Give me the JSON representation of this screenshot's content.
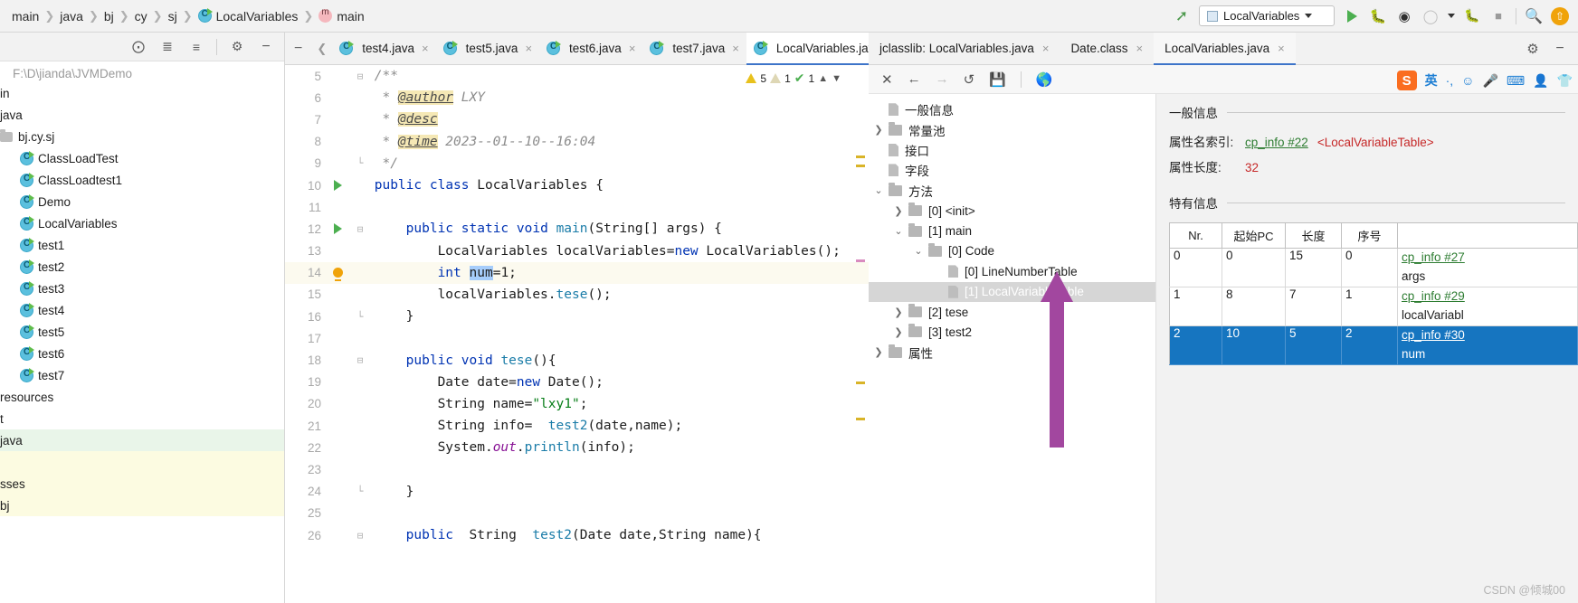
{
  "breadcrumb": {
    "items": [
      "main",
      "java",
      "bj",
      "cy",
      "sj"
    ],
    "class_name": "LocalVariables",
    "method_name": "main"
  },
  "toolbar": {
    "run_config": "LocalVariables",
    "icons": [
      "hammer-icon",
      "run-icon",
      "debug-icon",
      "run-coverage-icon",
      "profiler-icon",
      "attach-icon",
      "stop-icon",
      "search-icon",
      "update-icon"
    ]
  },
  "project_panel": {
    "toolbar_icons": [
      "locate-icon",
      "expand-all-icon",
      "collapse-all-icon",
      "settings-icon",
      "minimize-icon"
    ],
    "root_path": "F:\\D\\jianda\\JVMDemo",
    "items": [
      {
        "label": "in",
        "icon": "none",
        "indent": 0,
        "highlight": ""
      },
      {
        "label": "java",
        "icon": "none",
        "indent": 0,
        "highlight": ""
      },
      {
        "label": "bj.cy.sj",
        "icon": "folder",
        "indent": 0,
        "highlight": ""
      },
      {
        "label": "ClassLoadTest",
        "icon": "class",
        "indent": 1,
        "highlight": ""
      },
      {
        "label": "ClassLoadtest1",
        "icon": "class",
        "indent": 1,
        "highlight": ""
      },
      {
        "label": "Demo",
        "icon": "class",
        "indent": 1,
        "highlight": ""
      },
      {
        "label": "LocalVariables",
        "icon": "class",
        "indent": 1,
        "highlight": ""
      },
      {
        "label": "test1",
        "icon": "class",
        "indent": 1,
        "highlight": ""
      },
      {
        "label": "test2",
        "icon": "class",
        "indent": 1,
        "highlight": ""
      },
      {
        "label": "test3",
        "icon": "class",
        "indent": 1,
        "highlight": ""
      },
      {
        "label": "test4",
        "icon": "class",
        "indent": 1,
        "highlight": ""
      },
      {
        "label": "test5",
        "icon": "class",
        "indent": 1,
        "highlight": ""
      },
      {
        "label": "test6",
        "icon": "class",
        "indent": 1,
        "highlight": ""
      },
      {
        "label": "test7",
        "icon": "class",
        "indent": 1,
        "highlight": ""
      },
      {
        "label": "resources",
        "icon": "none",
        "indent": 0,
        "highlight": ""
      },
      {
        "label": "t",
        "icon": "none",
        "indent": 0,
        "highlight": ""
      },
      {
        "label": "java",
        "icon": "none",
        "indent": 0,
        "highlight": "green"
      },
      {
        "label": "",
        "icon": "none",
        "indent": 0,
        "highlight": "yellow"
      },
      {
        "label": "sses",
        "icon": "none",
        "indent": 0,
        "highlight": "yellow"
      },
      {
        "label": "bj",
        "icon": "none",
        "indent": 0,
        "highlight": "yellow"
      }
    ]
  },
  "editor": {
    "tabs": [
      {
        "label": "test4.java",
        "active": false
      },
      {
        "label": "test5.java",
        "active": false
      },
      {
        "label": "test6.java",
        "active": false
      },
      {
        "label": "test7.java",
        "active": false
      },
      {
        "label": "LocalVariables.java",
        "active": true
      }
    ],
    "inspections": {
      "warnings": "5",
      "weak_warnings": "1",
      "checks": "1"
    },
    "lines": [
      {
        "n": "5",
        "mark": "",
        "fold": "minus"
      },
      {
        "n": "6",
        "mark": "",
        "fold": ""
      },
      {
        "n": "7",
        "mark": "",
        "fold": ""
      },
      {
        "n": "8",
        "mark": "",
        "fold": ""
      },
      {
        "n": "9",
        "mark": "",
        "fold": "end"
      },
      {
        "n": "10",
        "mark": "run",
        "fold": ""
      },
      {
        "n": "11",
        "mark": "",
        "fold": ""
      },
      {
        "n": "12",
        "mark": "run",
        "fold": "minus"
      },
      {
        "n": "13",
        "mark": "",
        "fold": ""
      },
      {
        "n": "14",
        "mark": "bulb",
        "fold": "",
        "highlight": true
      },
      {
        "n": "15",
        "mark": "",
        "fold": ""
      },
      {
        "n": "16",
        "mark": "",
        "fold": "end"
      },
      {
        "n": "17",
        "mark": "",
        "fold": ""
      },
      {
        "n": "18",
        "mark": "",
        "fold": "minus"
      },
      {
        "n": "19",
        "mark": "",
        "fold": ""
      },
      {
        "n": "20",
        "mark": "",
        "fold": ""
      },
      {
        "n": "21",
        "mark": "",
        "fold": ""
      },
      {
        "n": "22",
        "mark": "",
        "fold": ""
      },
      {
        "n": "23",
        "mark": "",
        "fold": ""
      },
      {
        "n": "24",
        "mark": "",
        "fold": "end"
      },
      {
        "n": "25",
        "mark": "",
        "fold": ""
      },
      {
        "n": "26",
        "mark": "",
        "fold": "minus"
      }
    ],
    "code_text": [
      " /**",
      "  * @author LXY",
      "  * @desc",
      "  * @time 2023--01--10--16:04",
      "  */",
      " public class LocalVariables {",
      "",
      "     public static void main(String[] args) {",
      "         LocalVariables localVariables=new LocalVariables();",
      "         int num=1;",
      "         localVariables.tese();",
      "     }",
      "",
      "     public void tese(){",
      "         Date date=new Date();",
      "         String name=\"lxy1\";",
      "         String info=  test2(date,name);",
      "         System.out.println(info);",
      "",
      "     }",
      "",
      "     public  String  test2(Date date,String name){"
    ]
  },
  "jclasslib": {
    "tabs": [
      {
        "label": "jclasslib:   LocalVariables.java",
        "active": false,
        "closable": true
      },
      {
        "label": "Date.class",
        "active": false,
        "closable": true
      },
      {
        "label": "LocalVariables.java",
        "active": true,
        "closable": true
      }
    ],
    "toolbar_icons": [
      "close-icon",
      "back-icon",
      "forward-icon",
      "reload-icon",
      "save-icon",
      "browse-icon"
    ],
    "tree": [
      {
        "label": "一般信息",
        "icon": "doc",
        "indent": 1,
        "arrow": "",
        "selected": false
      },
      {
        "label": "常量池",
        "icon": "folder",
        "indent": 1,
        "arrow": "right",
        "selected": false
      },
      {
        "label": "接口",
        "icon": "doc",
        "indent": 1,
        "arrow": "",
        "selected": false
      },
      {
        "label": "字段",
        "icon": "doc",
        "indent": 1,
        "arrow": "",
        "selected": false
      },
      {
        "label": "方法",
        "icon": "folder",
        "indent": 1,
        "arrow": "down",
        "selected": false
      },
      {
        "label": "[0] <init>",
        "icon": "folder",
        "indent": 2,
        "arrow": "right",
        "selected": false
      },
      {
        "label": "[1] main",
        "icon": "folder",
        "indent": 2,
        "arrow": "down",
        "selected": false
      },
      {
        "label": "[0] Code",
        "icon": "folder",
        "indent": 3,
        "arrow": "down",
        "selected": false
      },
      {
        "label": "[0] LineNumberTable",
        "icon": "doc",
        "indent": 4,
        "arrow": "",
        "selected": false
      },
      {
        "label": "[1] LocalVariableTable",
        "icon": "doc",
        "indent": 4,
        "arrow": "",
        "selected": true
      },
      {
        "label": "[2] tese",
        "icon": "folder",
        "indent": 2,
        "arrow": "right",
        "selected": false
      },
      {
        "label": "[3] test2",
        "icon": "folder",
        "indent": 2,
        "arrow": "right",
        "selected": false
      },
      {
        "label": "属性",
        "icon": "folder",
        "indent": 1,
        "arrow": "right",
        "selected": false
      }
    ],
    "general_section": {
      "title": "一般信息",
      "attr_name_label": "属性名索引:",
      "attr_name_link": "cp_info #22",
      "attr_name_value": "<LocalVariableTable>",
      "attr_len_label": "属性长度:",
      "attr_len_value": "32"
    },
    "specific_section": {
      "title": "特有信息",
      "columns": [
        "Nr.",
        "起始PC",
        "长度",
        "序号",
        ""
      ],
      "rows": [
        {
          "nr": "0",
          "start_pc": "0",
          "length": "15",
          "index": "0",
          "name_link": "cp_info #27",
          "name_value": "args",
          "selected": false
        },
        {
          "nr": "1",
          "start_pc": "8",
          "length": "7",
          "index": "1",
          "name_link": "cp_info #29",
          "name_value": "localVariabl",
          "selected": false
        },
        {
          "nr": "2",
          "start_pc": "10",
          "length": "5",
          "index": "2",
          "name_link": "cp_info #30",
          "name_value": "num",
          "selected": true
        }
      ]
    }
  },
  "ime": {
    "app": "S",
    "mode": "英",
    "icons": [
      "punctuation-icon",
      "emoji-icon",
      "microphone-icon",
      "keyboard-icon",
      "contact-icon",
      "skin-icon"
    ]
  },
  "watermark": "CSDN @倾城00",
  "colors": {
    "accent": "#3d74c9",
    "selection_blue": "#1675c0",
    "keyword": "#0033b3",
    "string": "#067d17",
    "link_green": "#2e7d32",
    "arrow_purple": "#a councils"
  }
}
